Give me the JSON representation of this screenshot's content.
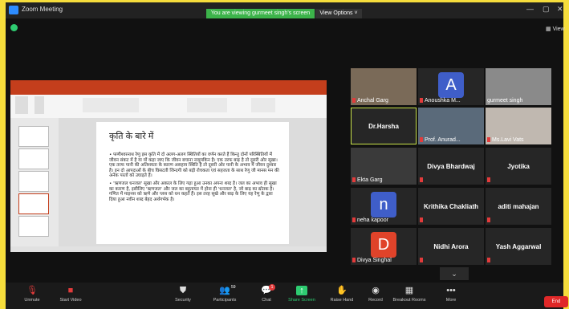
{
  "window": {
    "title": "Zoom Meeting",
    "banner": "You are viewing gurmeet singh's screen",
    "view_options": "View Options ˅",
    "view_mode": "View"
  },
  "slide": {
    "title": "कृति के बारे में",
    "bullet1": "फणीश्वरनाथ रेणु इस कृति में दो अलग-अलग स्थितियों का वर्णन करते हैं किन्तु दोनों परिस्थितियों में जीवन संकट में है या यों कहा जाए कि जीवन बचाना नामुमकिन है। एक तरफ बाढ़ है तो दूसरी ओर सूखा। एक तरफ पानी की अतिशयता के कारण असहाय स्थिति है तो दूसरी ओर पानी के अभाव में जीवन दुश्वार है। इन दो आपदाओं के बीच घिसटती जिन्दगी को बड़ी रोचकता एवं सहजता के साथ रेणु जी मानस मन की अनेक परतों को उघाड़ते हैं।",
    "bullet2": "'ऋणजल धनजल' सूखा और अकाल के लिए गढ़ा हुआ उनका अपना शब्द है। जल का अभाव ही सूखा का कारण है, इसीलिए 'ऋणजल' और जल का बहुतायत में होना ही 'धनजल' है, जो बाढ़ का द्योतक है। गणित में माइनस को ऋणे और प्लस को धन कहते हैं। इस तरह सूखे और बाढ़ के लिए यह रेणु के द्वारा दिया हुआ नवीन शब्द बेहद अर्थगर्भक है।"
  },
  "participants": [
    {
      "name": "Anchal Garg",
      "muted": true
    },
    {
      "name": "Anoushka M...",
      "initial": "A",
      "color": "#3f5ec9",
      "muted": true
    },
    {
      "name": "gurmeet singh",
      "muted": false
    },
    {
      "name": "Dr.Harsha",
      "muted": false
    },
    {
      "name": "Prof. Anurad...",
      "muted": true
    },
    {
      "name": "Ms.Lavi Vats",
      "muted": true
    },
    {
      "name": "Ekta Garg",
      "muted": true
    },
    {
      "name": "Divya  Bhardwaj",
      "muted": true
    },
    {
      "name": "Jyotika",
      "muted": true
    },
    {
      "name": "neha kapoor",
      "initial": "n",
      "color": "#3f5ec9",
      "muted": true
    },
    {
      "name": "Krithika Chakliath",
      "muted": true
    },
    {
      "name": "aditi mahajan",
      "muted": true
    },
    {
      "name": "Divya Singhal",
      "initial": "D",
      "color": "#e0432a",
      "muted": true
    },
    {
      "name": "Nidhi Arora",
      "muted": true
    },
    {
      "name": "Yash Aggarwal",
      "muted": true
    }
  ],
  "toolbar": {
    "unmute": "Unmute",
    "start_video": "Start Video",
    "security": "Security",
    "participants": "Participants",
    "participants_count": "59",
    "chat": "Chat",
    "chat_badge": "1",
    "share_screen": "Share Screen",
    "raise_hand": "Raise Hand",
    "record": "Record",
    "breakout": "Breakout Rooms",
    "more": "More",
    "end": "End"
  }
}
